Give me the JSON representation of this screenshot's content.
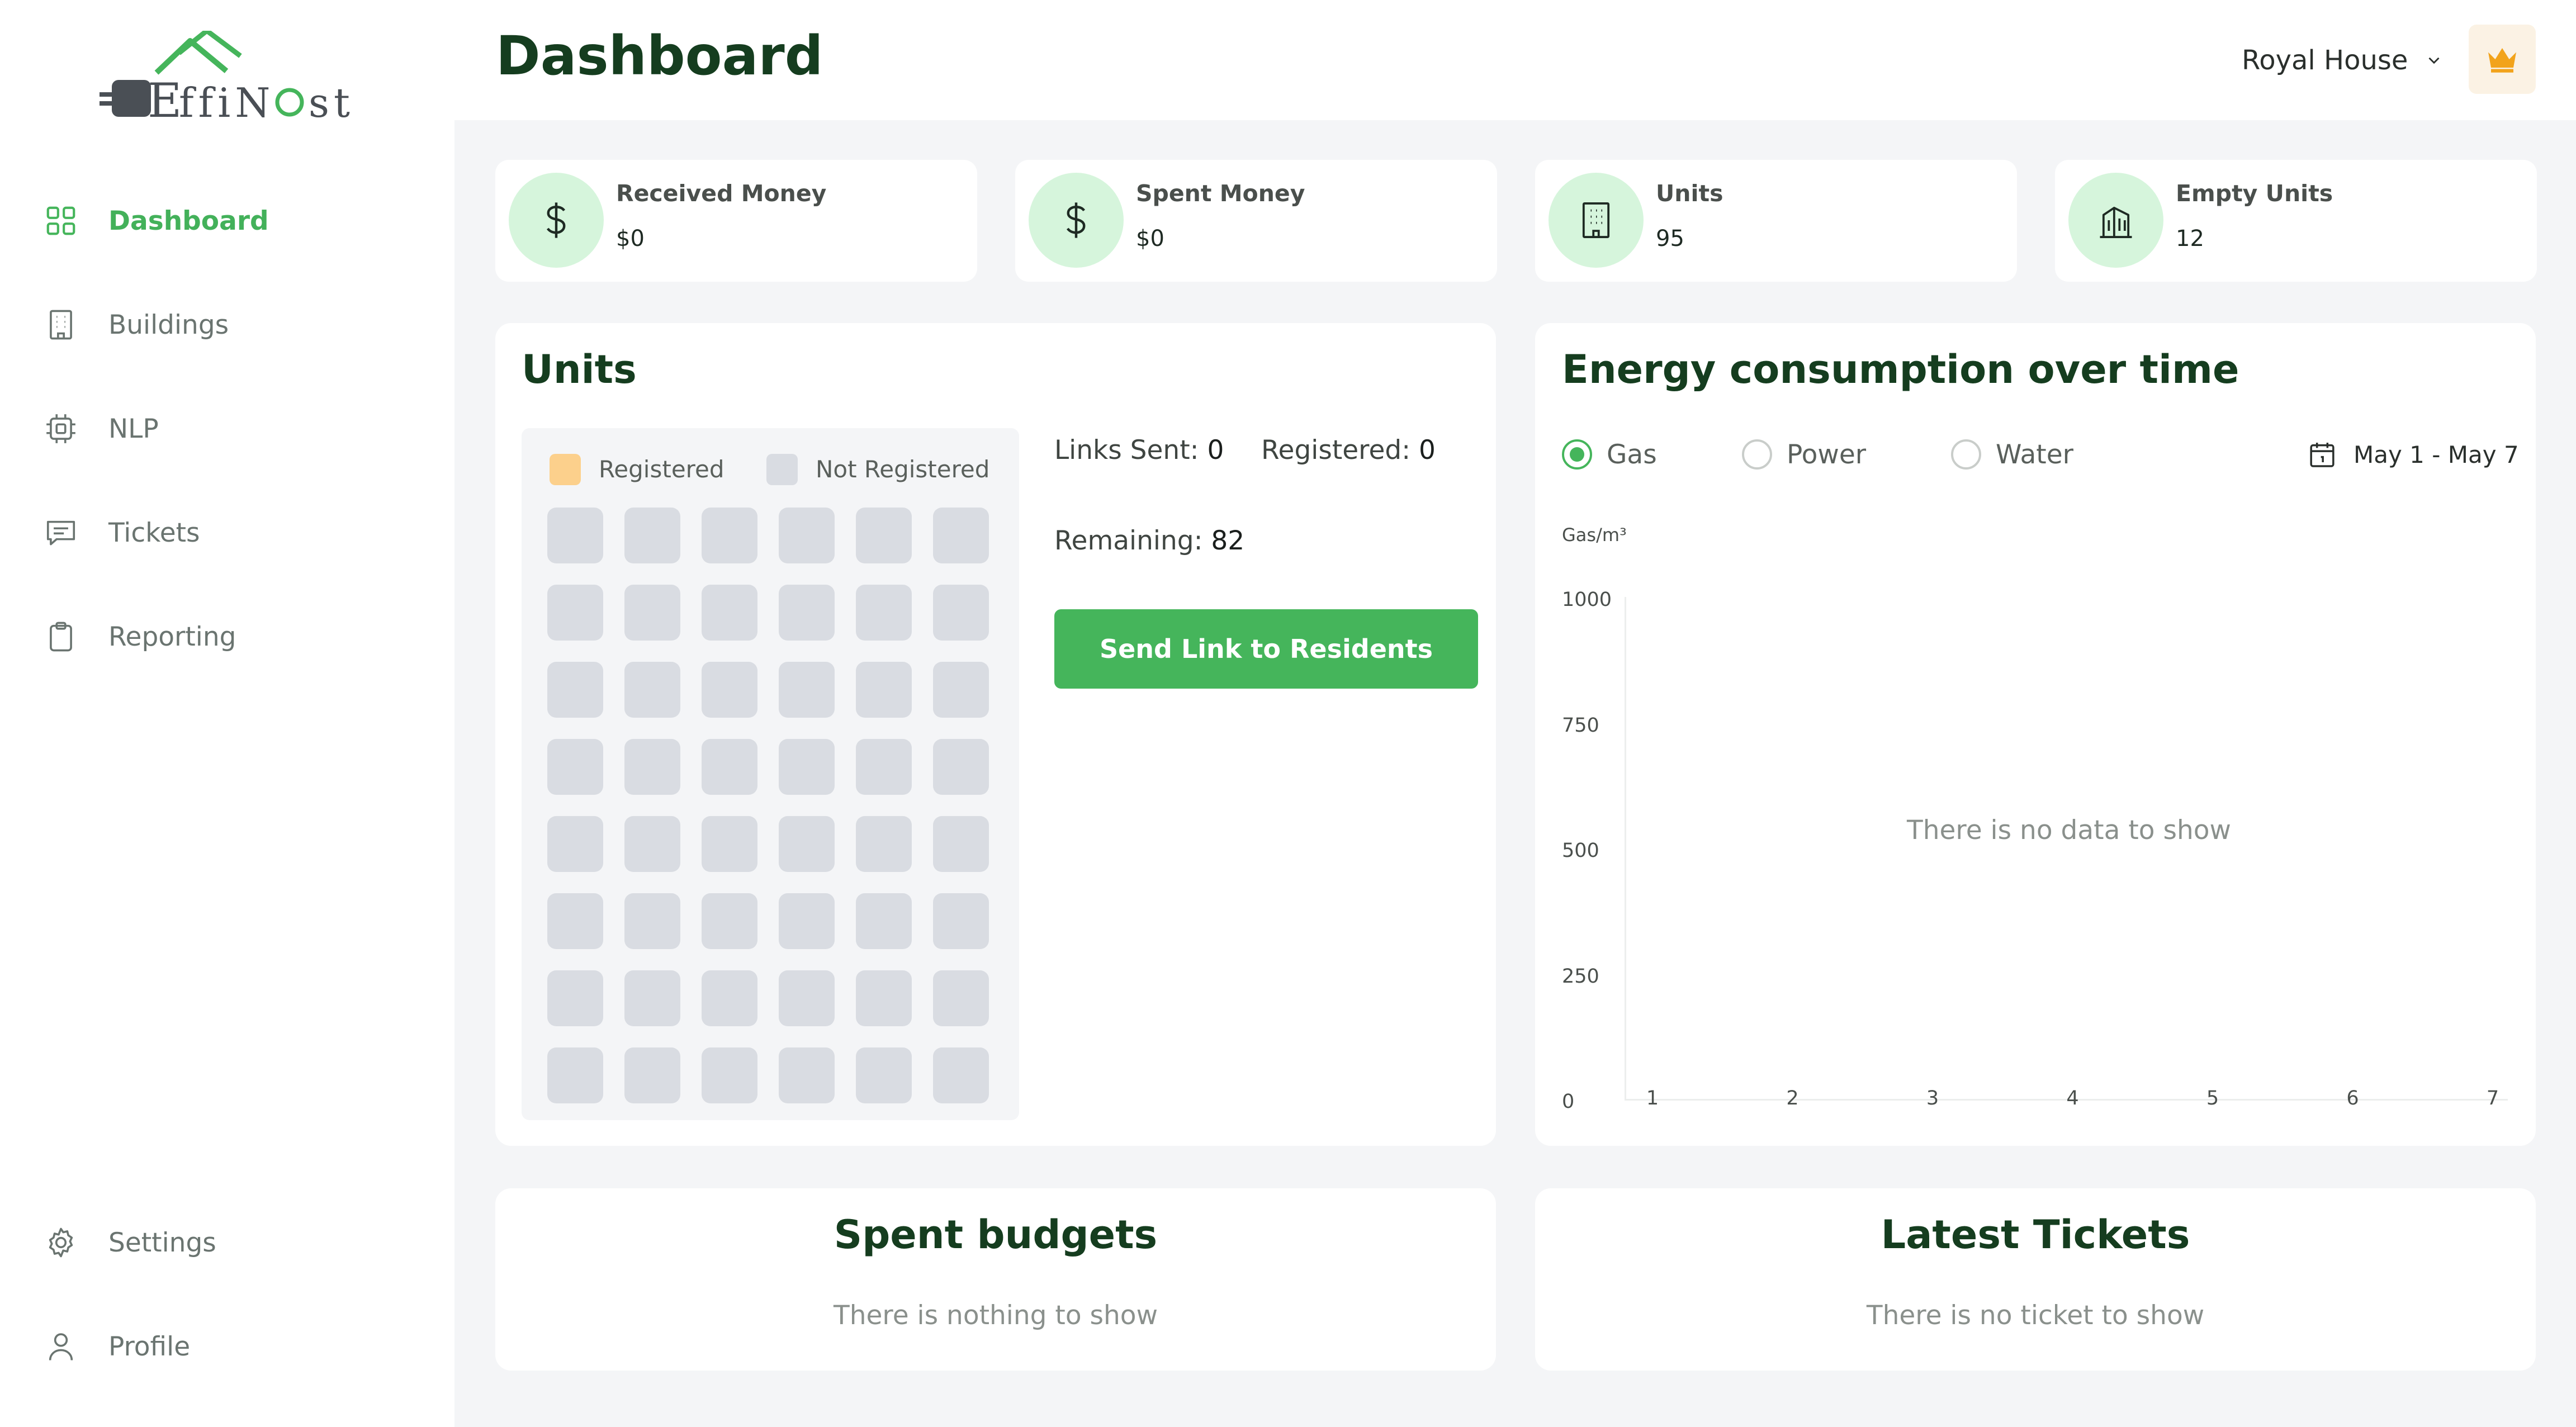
{
  "app": {
    "logo_text": "EffiNest"
  },
  "sidebar": {
    "items": [
      {
        "label": "Dashboard",
        "icon": "grid-icon",
        "active": true
      },
      {
        "label": "Buildings",
        "icon": "building-icon"
      },
      {
        "label": "NLP",
        "icon": "chip-icon"
      },
      {
        "label": "Tickets",
        "icon": "message-icon"
      },
      {
        "label": "Reporting",
        "icon": "clipboard-icon"
      }
    ],
    "bottom_items": [
      {
        "label": "Settings",
        "icon": "gear-icon"
      },
      {
        "label": "Profile",
        "icon": "user-icon"
      }
    ]
  },
  "header": {
    "title": "Dashboard",
    "organization": "Royal House",
    "premium_icon": "crown-icon"
  },
  "stats": [
    {
      "title": "Received Money",
      "value": "$0",
      "icon": "dollar-icon"
    },
    {
      "title": "Spent Money",
      "value": "$0",
      "icon": "dollar-icon"
    },
    {
      "title": "Units",
      "value": "95",
      "icon": "building-icon"
    },
    {
      "title": "Empty Units",
      "value": "12",
      "icon": "buildings-icon"
    }
  ],
  "units_panel": {
    "title": "Units",
    "legend": {
      "registered": "Registered",
      "not_registered": "Not Registered"
    },
    "legend_colors": {
      "registered": "#fcd08c",
      "not_registered": "#d9dce2"
    },
    "grid": {
      "columns": 6,
      "rows": 8
    },
    "links_sent_label": "Links Sent:",
    "links_sent": "0",
    "registered_label": "Registered:",
    "registered": "0",
    "remaining_label": "Remaining:",
    "remaining": "82",
    "send_button": "Send Link to Residents"
  },
  "energy_panel": {
    "title": "Energy consumption over time",
    "options": [
      "Gas",
      "Power",
      "Water"
    ],
    "selected": "Gas",
    "date_range": "May 1 - May 7",
    "empty_text": "There is no data to show"
  },
  "chart_data": {
    "type": "line",
    "title": "",
    "ylabel": "Gas/m³",
    "xlabel": "",
    "x": [
      "1",
      "2",
      "3",
      "4",
      "5",
      "6",
      "7"
    ],
    "yticks": [
      "1000",
      "750",
      "500",
      "250",
      "0"
    ],
    "ylim": [
      0,
      1000
    ],
    "series": [],
    "grid": false
  },
  "spent_budgets": {
    "title": "Spent budgets",
    "empty_text": "There is nothing to show"
  },
  "latest_tickets": {
    "title": "Latest Tickets",
    "empty_text": "There is no ticket to show"
  },
  "colors": {
    "accent": "#45b55b",
    "title": "#153d1f",
    "icon_bg": "#d6f5dc"
  }
}
